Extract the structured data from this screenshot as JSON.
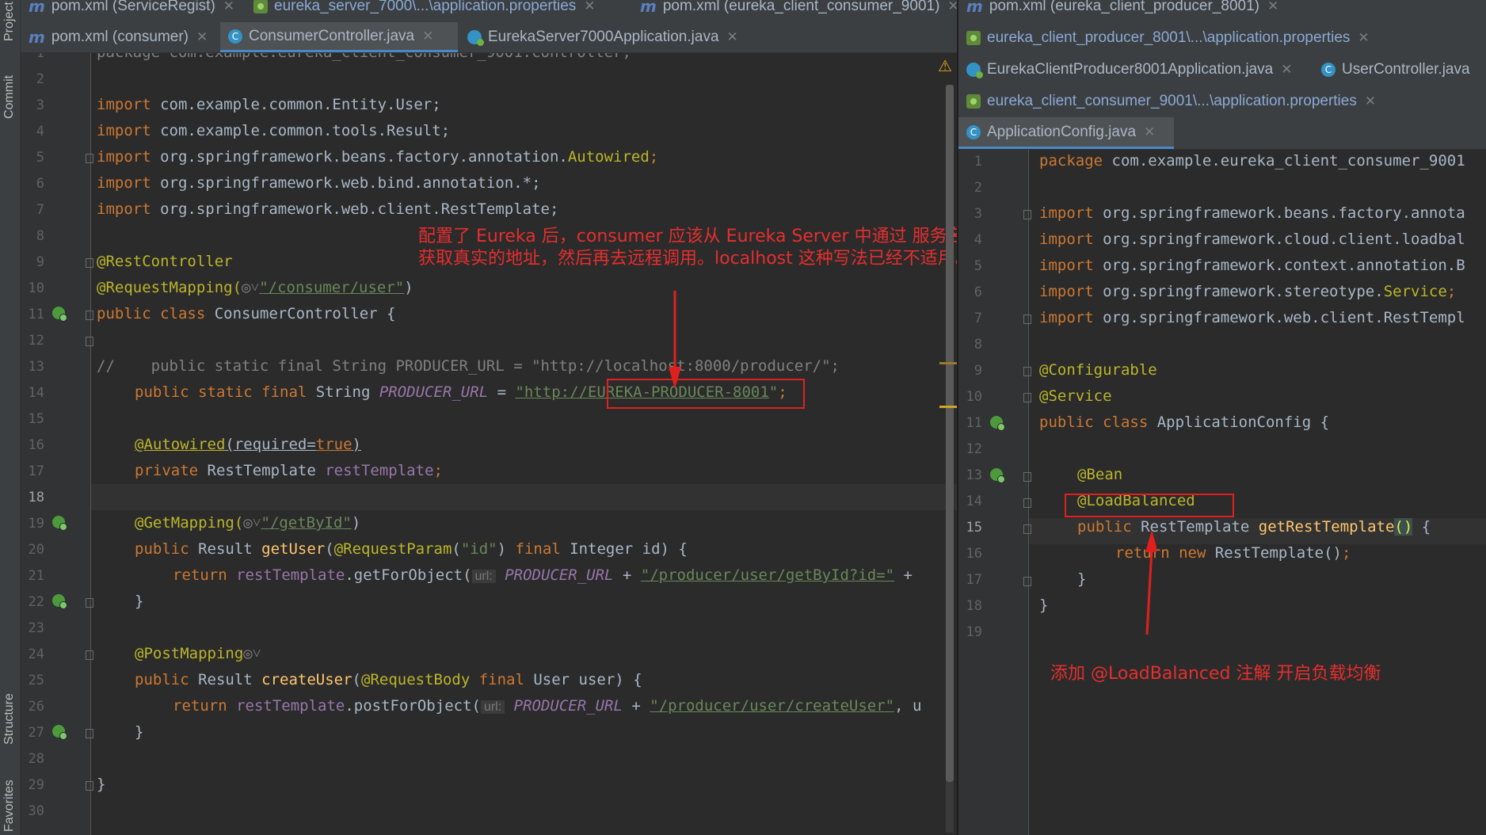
{
  "left_strip": {
    "project": "Project",
    "commit": "Commit",
    "structure": "Structure",
    "favorites": "Favorites"
  },
  "tabs_left_row1": [
    {
      "label": "pom.xml (ServiceRegist)",
      "kind": "maven"
    },
    {
      "label": "eureka_server_7000\\...\\application.properties",
      "kind": "props"
    },
    {
      "label": "pom.xml (eureka_client_consumer_9001)",
      "kind": "maven"
    }
  ],
  "tabs_left_row2": [
    {
      "label": "pom.xml (consumer)",
      "kind": "maven"
    },
    {
      "label": "ConsumerController.java",
      "kind": "class",
      "active": true
    },
    {
      "label": "EurekaServer7000Application.java",
      "kind": "spring"
    }
  ],
  "tabs_right": [
    {
      "label": "pom.xml (eureka_client_producer_8001)",
      "kind": "maven"
    },
    {
      "label": "eureka_client_producer_8001\\...\\application.properties",
      "kind": "props"
    },
    {
      "label": "EurekaClientProducer8001Application.java",
      "kind": "spring"
    },
    {
      "label": "UserController.java",
      "kind": "class"
    },
    {
      "label": "eureka_client_consumer_9001\\...\\application.properties",
      "kind": "props"
    },
    {
      "label": "ApplicationConfig.java",
      "kind": "class",
      "active": true
    }
  ],
  "left_editor": {
    "line_numbers": [
      "1",
      "2",
      "3",
      "4",
      "5",
      "6",
      "7",
      "8",
      "9",
      "10",
      "11",
      "12",
      "13",
      "14",
      "15",
      "16",
      "17",
      "18",
      "19",
      "20",
      "21",
      "22",
      "23",
      "24",
      "25",
      "26",
      "27",
      "28",
      "29",
      "30"
    ],
    "current_line": "18",
    "code": {
      "l1": "package com.example.eureka_client_consumer_9001.controller;",
      "l3_kw": "import",
      "l3": " com.example.common.Entity.User;",
      "l4_kw": "import",
      "l4": " com.example.common.tools.Result;",
      "l5_kw": "import",
      "l5a": " org.springframework.beans.factory.annotation.",
      "l5b": "Autowired",
      "l5c": ";",
      "l6_kw": "import",
      "l6": " org.springframework.web.bind.annotation.*;",
      "l7_kw": "import",
      "l7": " org.springframework.web.client.RestTemplate;",
      "l9": "@RestController",
      "l10a": "@RequestMapping(",
      "l10b": "\"/consumer/user\"",
      "l10c": ")",
      "l11a": "public class",
      "l11b": " ConsumerController {",
      "l13": "//    public static final String PRODUCER_URL = \"http://localhost:8000/producer/\";",
      "l14a": "public static final",
      "l14b": " String ",
      "l14c": "PRODUCER_URL",
      "l14d": " = ",
      "l14e": "\"http://",
      "l14f": "EUREKA-PRODUCER-8001",
      "l14g": "\"",
      "l14h": ";",
      "l16a": "@Autowired",
      "l16b": "(required=",
      "l16c": "true",
      "l16d": ")",
      "l17a": "private",
      "l17b": " RestTemplate ",
      "l17c": "restTemplate",
      "l17d": ";",
      "l19a": "@GetMapping(",
      "l19b": "\"/getById\"",
      "l19c": ")",
      "l20a": "public",
      "l20b": " Result ",
      "l20c": "getUser",
      "l20d": "(",
      "l20e": "@RequestParam",
      "l20f": "(",
      "l20g": "\"id\"",
      "l20h": ") ",
      "l20i": "final",
      "l20j": " Integer id) {",
      "l21a": "return",
      "l21b": " restTemplate",
      "l21c": ".getForObject(",
      "l21hint": "url:",
      "l21d": " PRODUCER_URL",
      "l21e": " + ",
      "l21f": "\"/producer/user/getById?id=\"",
      "l21g": " +",
      "l22": "}",
      "l24": "@PostMapping",
      "l25a": "public",
      "l25b": " Result ",
      "l25c": "createUser",
      "l25d": "(",
      "l25e": "@RequestBody",
      "l25f": " final",
      "l25g": " User user) {",
      "l26a": "return",
      "l26b": " restTemplate",
      "l26c": ".postForObject(",
      "l26hint": "url:",
      "l26d": " PRODUCER_URL",
      "l26e": " + ",
      "l26f": "\"/producer/user/createUser\"",
      "l26g": ", u",
      "l27": "}",
      "l29": "}"
    },
    "warning_icon": "warning-triangle-icon"
  },
  "right_editor": {
    "line_numbers": [
      "1",
      "2",
      "3",
      "4",
      "5",
      "6",
      "7",
      "8",
      "9",
      "10",
      "11",
      "12",
      "13",
      "14",
      "15",
      "16",
      "17",
      "18",
      "19"
    ],
    "current_line": "15",
    "code": {
      "l1a": "package",
      "l1b": " com.example.eureka_client_consumer_9001",
      "l3_kw": "import",
      "l3": " org.springframework.beans.factory.annota",
      "l4_kw": "import",
      "l4": " org.springframework.cloud.client.loadbal",
      "l5_kw": "import",
      "l5": " org.springframework.context.annotation.B",
      "l6_kw": "import",
      "l6a": " org.springframework.stereotype.",
      "l6b": "Service",
      "l6c": ";",
      "l7_kw": "import",
      "l7": " org.springframework.web.client.RestTempl",
      "l9": "@Configurable",
      "l10": "@Service",
      "l11a": "public class",
      "l11b": " ApplicationConfig {",
      "l13": "@Bean",
      "l14": "@LoadBalanced",
      "l15a": "public",
      "l15b": " RestTemplate ",
      "l15c": "getRestTemplate",
      "l15d": "()",
      "l15e": " {",
      "l16a": "return new",
      "l16b": " RestTemplate()",
      "l16c": ";",
      "l17": "}",
      "l18": "}"
    }
  },
  "annotations": {
    "note_left_line1": "配置了 Eureka 后，consumer 应该从 Eureka Server 中通过 服务名",
    "note_left_line2": "获取真实的地址，然后再去远程调用。localhost 这种写法已经不适用。",
    "note_right": "添加 @LoadBalanced 注解 开启负载均衡"
  },
  "colors": {
    "accent_red": "#e02020",
    "keyword": "#cc7832",
    "annotation": "#bbb529",
    "string": "#6a8759",
    "field": "#9876aa",
    "method": "#ffc66d",
    "background": "#2b2b2b"
  }
}
